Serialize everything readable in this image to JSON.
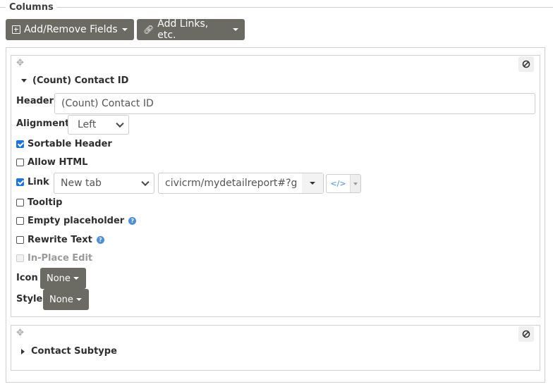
{
  "fieldset": {
    "legend": "Columns"
  },
  "toolbar": {
    "add_remove_fields": {
      "label": "Add/Remove Fields",
      "icon": "plus-square-icon"
    },
    "add_links": {
      "label": "Add Links, etc.",
      "icon": "link-icon"
    }
  },
  "columns": [
    {
      "title": "(Count) Contact ID",
      "expanded": true,
      "header_label": "Header",
      "header_value": "(Count) Contact ID",
      "alignment_label": "Alignment",
      "alignment_value": "Left",
      "sortable_label": "Sortable Header",
      "sortable_checked": true,
      "allow_html_label": "Allow HTML",
      "allow_html_checked": false,
      "link_label": "Link",
      "link_checked": true,
      "link_target": "New tab",
      "link_path": "civicrm/mydetailreport#?g",
      "tooltip_label": "Tooltip",
      "tooltip_checked": false,
      "empty_placeholder_label": "Empty placeholder",
      "empty_placeholder_checked": false,
      "rewrite_text_label": "Rewrite Text",
      "rewrite_text_checked": false,
      "in_place_edit_label": "In-Place Edit",
      "in_place_edit_disabled": true,
      "icon_label": "Icon",
      "icon_value": "None",
      "style_label": "Style",
      "style_value": "None"
    },
    {
      "title": "Contact Subtype",
      "expanded": false
    }
  ],
  "colors": {
    "button_dark": "#6b6b63",
    "checkbox_accent": "#1a73e8",
    "help_icon": "#4a90d9"
  }
}
